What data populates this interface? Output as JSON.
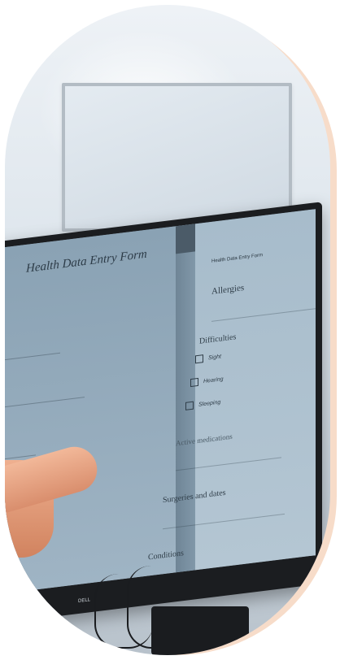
{
  "screen": {
    "left_title": "Health Data Entry Form",
    "form_header": "Health Data Entry Form",
    "sections": {
      "allergies": "Allergies",
      "difficulties": "Difficulties",
      "active_medications": "Active medications",
      "surgeries": "Surgeries and dates",
      "conditions": "Conditions"
    },
    "checkboxes": [
      {
        "label": "Sight"
      },
      {
        "label": "Hearing"
      },
      {
        "label": "Sleeping"
      }
    ],
    "brand": "DELL"
  }
}
